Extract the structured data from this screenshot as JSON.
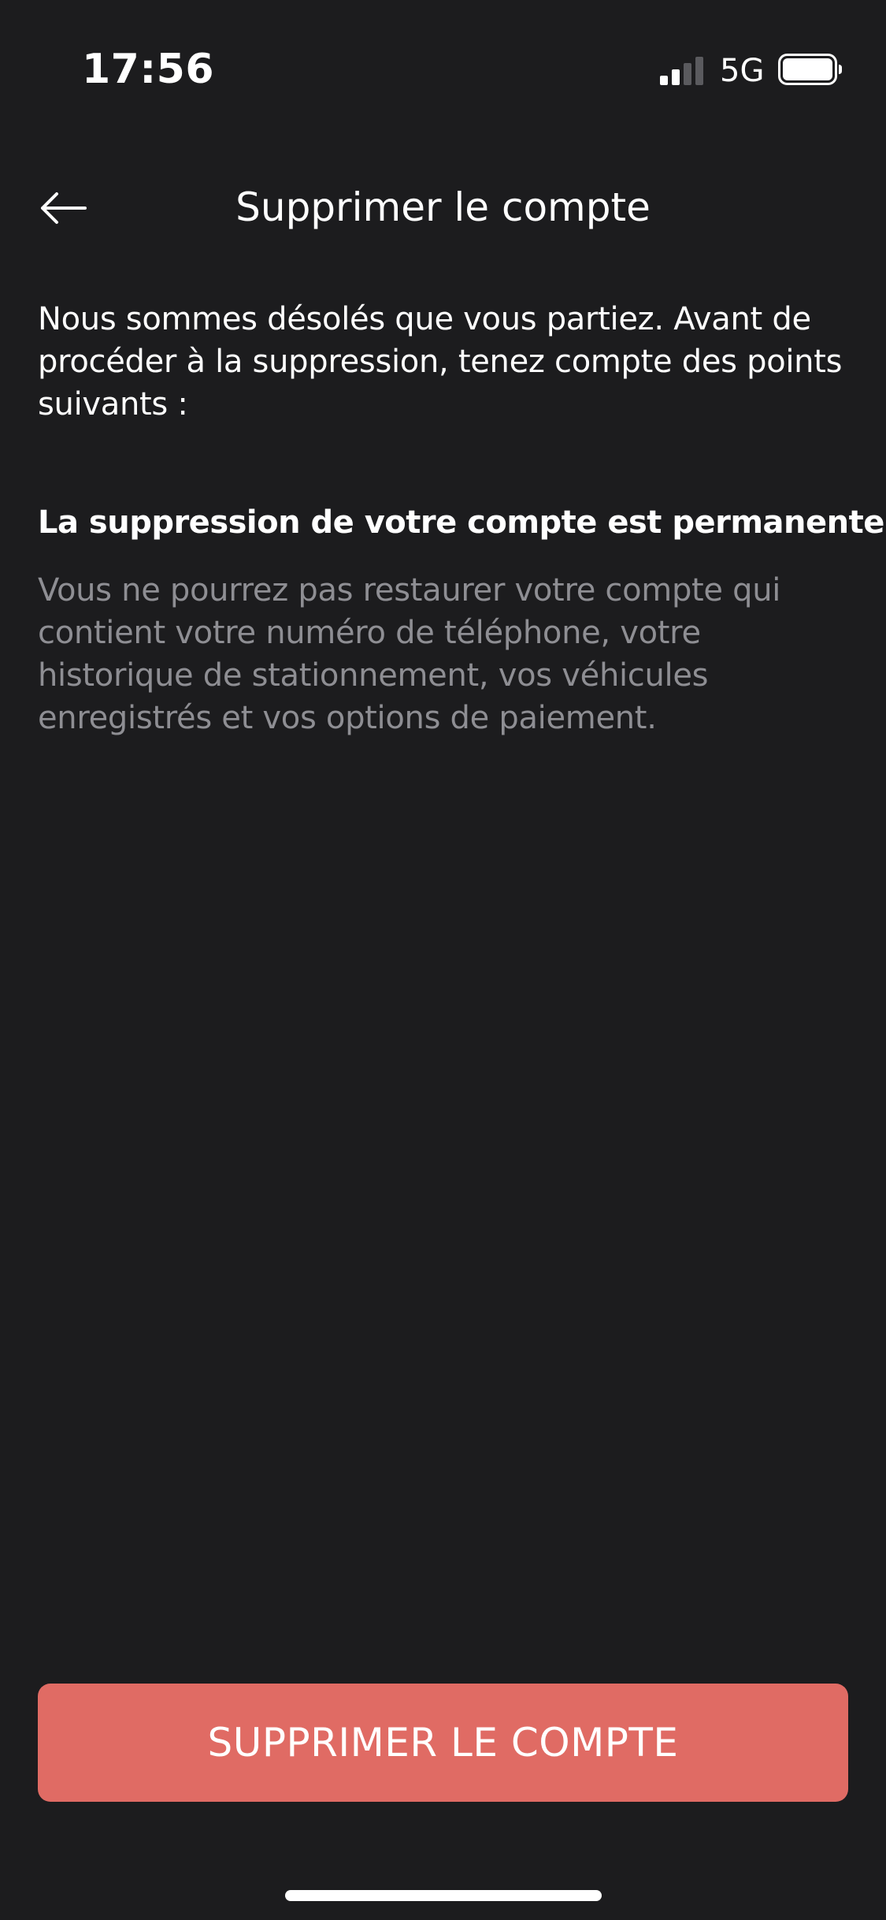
{
  "status_bar": {
    "time": "17:56",
    "network": "5G",
    "signal_icon": "signal-bars-icon",
    "battery_icon": "battery-icon"
  },
  "nav": {
    "back_icon": "arrow-left-icon",
    "title": "Supprimer le compte"
  },
  "content": {
    "intro": "Nous sommes désolés que vous partiez. Avant de procéder à la suppression, tenez compte des points suivants :",
    "section_heading": "La suppression de votre compte est permanente",
    "section_body": "Vous ne pourrez pas restaurer votre compte qui contient votre numéro de téléphone, votre historique de stationnement, vos véhicules enregistrés et vos options de paiement."
  },
  "actions": {
    "delete_label": "SUPPRIMER LE COMPTE"
  },
  "colors": {
    "background": "#1c1c1e",
    "text_primary": "#ffffff",
    "text_secondary": "#8e8e93",
    "danger_button": "#e06b64"
  }
}
